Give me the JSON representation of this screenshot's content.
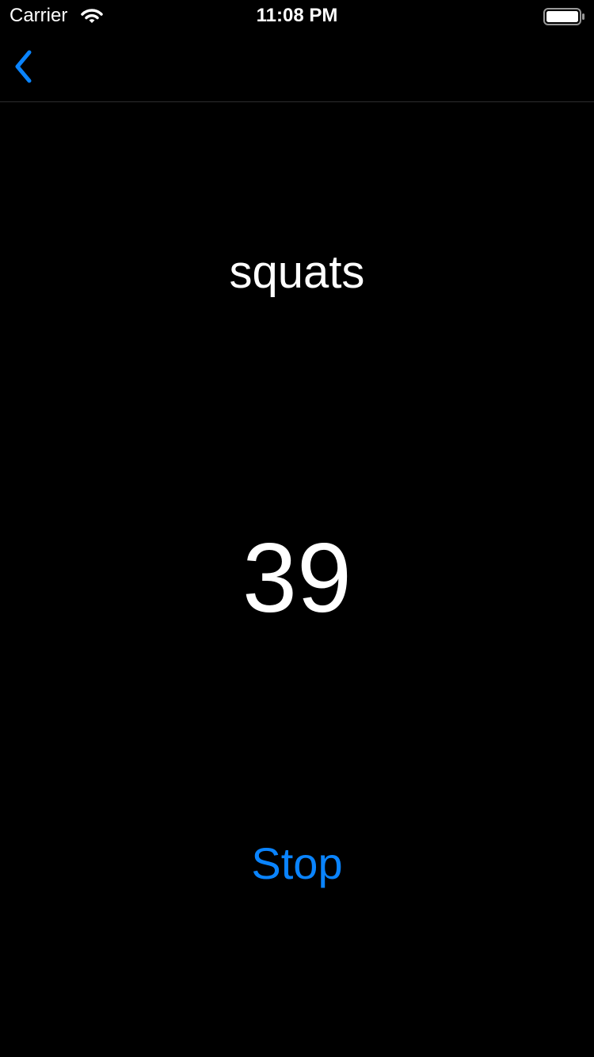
{
  "status_bar": {
    "carrier": "Carrier",
    "time": "11:08 PM",
    "wifi_icon": "wifi-icon",
    "battery_icon": "battery-icon"
  },
  "nav": {
    "back_icon": "chevron-left-icon"
  },
  "workout": {
    "exercise": "squats",
    "count": "39",
    "stop_label": "Stop"
  },
  "colors": {
    "background": "#000000",
    "text": "#ffffff",
    "accent": "#0a84ff",
    "separator": "#2c2c2e"
  }
}
